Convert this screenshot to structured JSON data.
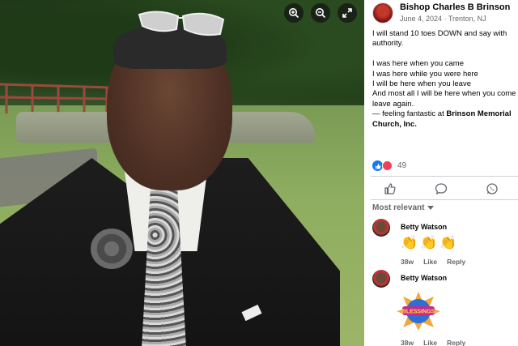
{
  "viewer": {
    "icons": [
      "zoom-in-icon",
      "zoom-out-icon",
      "fullscreen-icon"
    ]
  },
  "post": {
    "author": "Bishop Charles B Brinson",
    "date": "June 4, 2024",
    "separator": " · ",
    "location": "Trenton, NJ",
    "privacy_icon": "globe-icon",
    "text_intro": "I will stand 10 toes DOWN and say with authority.",
    "text_poem": "I was here when you came\nI was here while you were here\nI will be here when you leave\nAnd most all I will be here when you come and leave again.",
    "feeling_prefix": "— feeling fantastic at ",
    "feeling_place": "Brinson Memorial Church, Inc.",
    "reaction_count": "49"
  },
  "actions": {
    "icons": [
      "like-icon",
      "comment-icon",
      "whatsapp-icon"
    ]
  },
  "comments_sort": "Most relevant",
  "comments": [
    {
      "name": "Betty Watson",
      "content": "👏👏👏",
      "time": "38w",
      "like": "Like",
      "reply": "Reply"
    },
    {
      "name": "Betty Watson",
      "content": "Blessings sticker",
      "time": "38w",
      "like": "Like",
      "reply": "Reply"
    }
  ],
  "colors": {
    "facebook_blue": "#1877f2",
    "love_red": "#f33e58",
    "meta_gray": "#65676b"
  }
}
